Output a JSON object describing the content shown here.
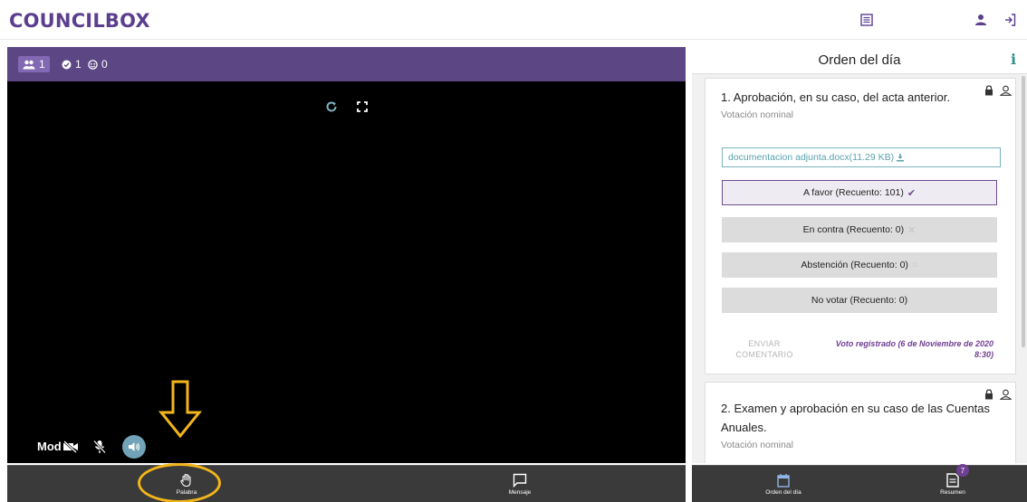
{
  "header": {
    "logo": "COUNCILBOX"
  },
  "video": {
    "stats": {
      "participants": "1",
      "online": "1",
      "guests": "0"
    },
    "mod_label": "Mod"
  },
  "toolbar": {
    "palabra_label": "Palabra",
    "mensaje_label": "Mensaje",
    "orden_label": "Orden del día",
    "resumen_label": "Resumen",
    "resumen_badge": "7"
  },
  "agenda": {
    "title": "Orden del día",
    "items": [
      {
        "title": "1. Aprobación, en su caso, del acta anterior.",
        "subtitle": "Votación nominal",
        "attachment": "documentacion adjunta.docx(11.29 KB)",
        "options": [
          {
            "label": "A favor (Recuento: 101)",
            "selected": true,
            "mark": "✔"
          },
          {
            "label": "En contra (Recuento: 0)",
            "selected": false,
            "mark": "✕"
          },
          {
            "label": "Abstención (Recuento: 0)",
            "selected": false,
            "mark": "○"
          },
          {
            "label": "No votar (Recuento: 0)",
            "selected": false,
            "mark": ""
          }
        ],
        "send_comment": "ENVIAR COMENTARIO",
        "vote_registered": "Voto registrado (6 de Noviembre de 2020 8:30)"
      },
      {
        "title_line1": "2. Examen y aprobación en su caso de las Cuentas",
        "title_line2": "Anuales.",
        "subtitle": "Votación nominal"
      }
    ]
  },
  "colors": {
    "brand": "#5b3f8e",
    "video_topbar": "#5d4684",
    "accent_teal": "#5aa2ad",
    "annotation": "#f2b51a"
  }
}
